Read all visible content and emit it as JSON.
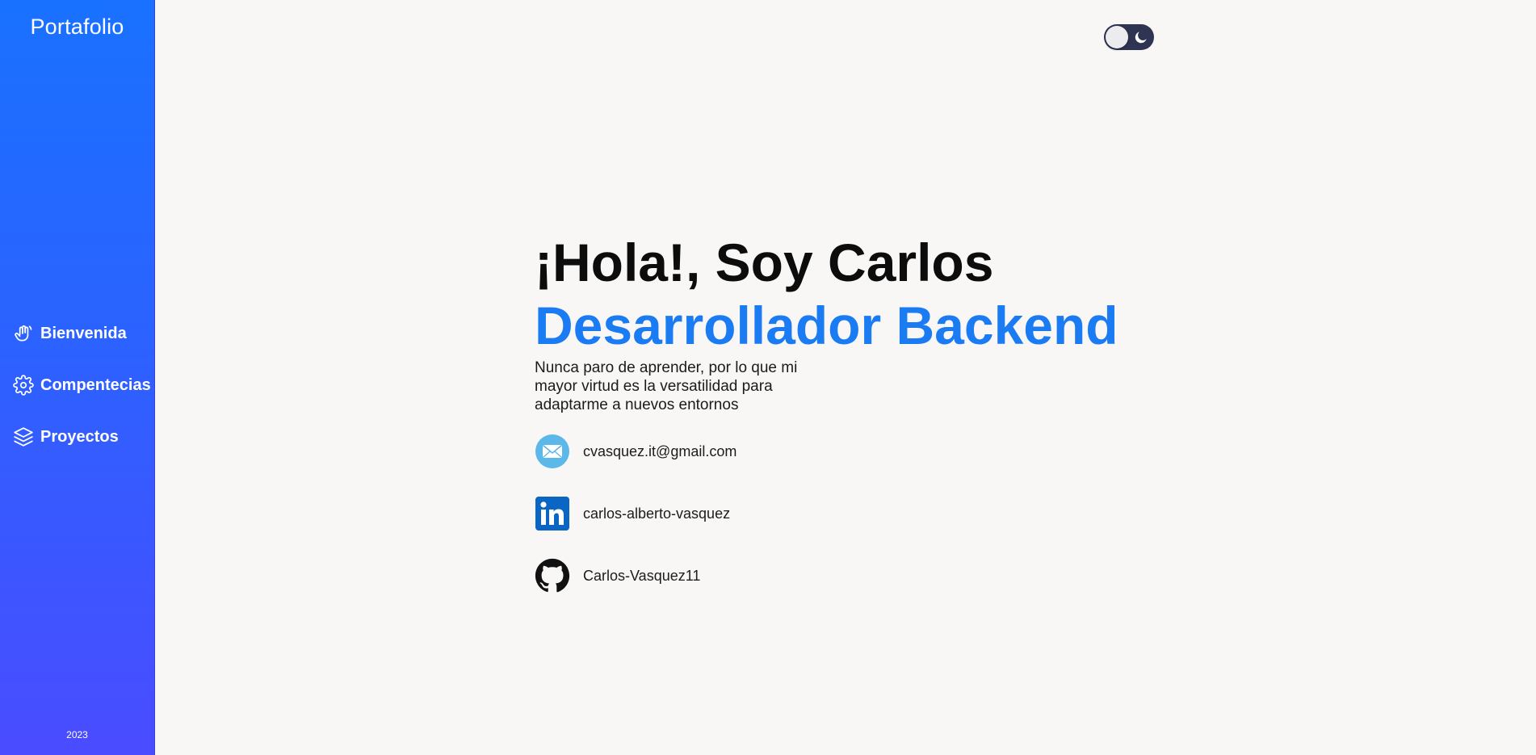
{
  "sidebar": {
    "brand": "Portafolio",
    "items": [
      {
        "label": "Bienvenida",
        "icon": "wave-hand-icon"
      },
      {
        "label": "Compentecias",
        "icon": "gear-icon"
      },
      {
        "label": "Proyectos",
        "icon": "layers-icon"
      }
    ],
    "year": "2023"
  },
  "theme_toggle": {
    "icon": "moon-icon",
    "state": "off"
  },
  "hero": {
    "greeting": "¡Hola!, Soy Carlos",
    "role": "Desarrollador Backend",
    "tagline": "Nunca paro de aprender, por lo que mi mayor virtud es la versatilidad para adaptarme a nuevos entornos"
  },
  "contacts": [
    {
      "icon": "email-icon",
      "text": "cvasquez.it@gmail.com"
    },
    {
      "icon": "linkedin-icon",
      "text": "carlos-alberto-vasquez"
    },
    {
      "icon": "github-icon",
      "text": "Carlos-Vasquez11"
    }
  ],
  "colors": {
    "sidebar_top": "#1971ff",
    "sidebar_bottom": "#4a4cff",
    "accent": "#1a7bf2",
    "background": "#f8f7f6",
    "toggle_track": "#2f3452"
  }
}
